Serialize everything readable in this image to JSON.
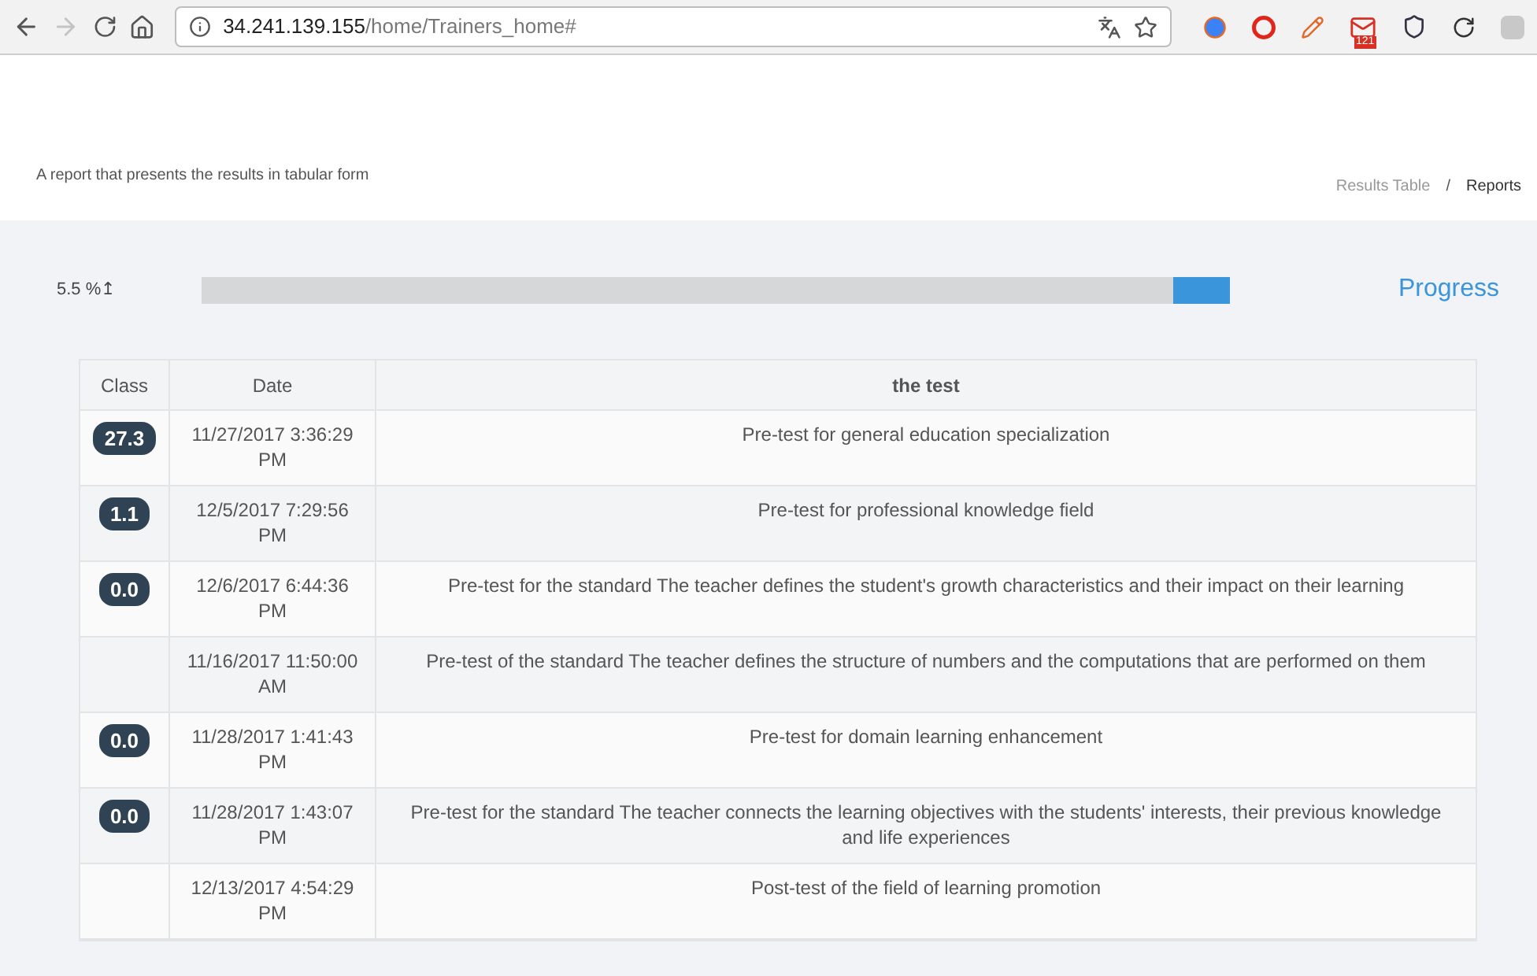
{
  "browser": {
    "url_host": "34.241.139.155",
    "url_path": "/home/Trainers_home#",
    "forward_disabled": true,
    "mail_badge": "121"
  },
  "header": {
    "subtitle": "A report that presents the results in tabular form",
    "breadcrumb": [
      {
        "label": "Results Table",
        "selected": false
      },
      {
        "label": "/",
        "kind": "separator"
      },
      {
        "label": "Reports",
        "selected": true
      }
    ]
  },
  "progress": {
    "reading": "5.5 %↥",
    "level": 0.055,
    "title": "Progress"
  },
  "table": {
    "columns": [
      "Class",
      "Date",
      "the test"
    ],
    "rows": [
      {
        "class": "27.3",
        "date": "11/27/2017 3:36:29 PM",
        "test": "Pre-test for general education specialization"
      },
      {
        "class": "1.1",
        "date": "12/5/2017 7:29:56 PM",
        "test": "Pre-test for professional knowledge field"
      },
      {
        "class": "0.0",
        "date": "12/6/2017 6:44:36 PM",
        "test": "Pre-test for the standard The teacher defines the student's growth characteristics and their impact on their learning"
      },
      {
        "date": "11/16/2017 11:50:00 AM",
        "test": "Pre-test of the standard The teacher defines the structure of numbers and the computations that are performed on them"
      },
      {
        "class": "0.0",
        "date": "11/28/2017 1:41:43 PM",
        "test": "Pre-test for domain learning enhancement"
      },
      {
        "class": "0.0",
        "date": "11/28/2017 1:43:07 PM",
        "test": "Pre-test for the standard The teacher connects the learning objectives with the students' interests, their previous knowledge and life experiences"
      },
      {
        "date": "12/13/2017 4:54:29 PM",
        "test": "Post-test of the field of learning promotion"
      }
    ]
  }
}
